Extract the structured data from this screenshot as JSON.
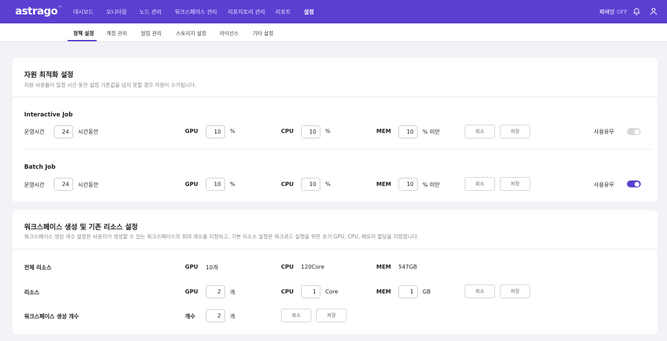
{
  "nav": {
    "logo": "astrago",
    "items": [
      "대시보드",
      "모니터링",
      "노드 관리",
      "워크스페이스 관리",
      "리포지토리 관리",
      "리포트",
      "설정"
    ],
    "active": "설정",
    "right_label": "폐쇄망",
    "right_state": "OFF"
  },
  "subnav": {
    "items": [
      "정책 설정",
      "계정 관리",
      "알림 관리",
      "스토리지 설정",
      "라이선스",
      "기타 설정"
    ],
    "active": "정책 설정"
  },
  "resource_opt": {
    "title": "자원 최적화 설정",
    "desc": "자원 사용률이 일정 시간 동안 설정 기준값을 넘지 못할 경우 자원이 수거됩니다.",
    "interactive": {
      "title": "Interactive Job",
      "runtime_label": "운영시간",
      "runtime_value": "24",
      "runtime_unit": "시간동안",
      "gpu_label": "GPU",
      "gpu_value": "10",
      "gpu_unit": "%",
      "cpu_label": "CPU",
      "cpu_value": "10",
      "cpu_unit": "%",
      "mem_label": "MEM",
      "mem_value": "10",
      "mem_unit": "% 미만",
      "cancel": "취소",
      "save": "저장",
      "use_label": "사용유무",
      "enabled": false
    },
    "batch": {
      "title": "Batch Job",
      "runtime_label": "운영시간",
      "runtime_value": "24",
      "runtime_unit": "시간동안",
      "gpu_label": "GPU",
      "gpu_value": "10",
      "gpu_unit": "%",
      "cpu_label": "CPU",
      "cpu_value": "10",
      "cpu_unit": "%",
      "mem_label": "MEM",
      "mem_value": "10",
      "mem_unit": "% 미만",
      "cancel": "취소",
      "save": "저장",
      "use_label": "사용유무",
      "enabled": true
    }
  },
  "workspace": {
    "title": "워크스페이스 생성 및 기존 리소스 설정",
    "desc": "워크스페이스 생성 개수 설정은 사용자가 생성할 수 있는 워크스페이스의 최대 개수를 지정하고, 기본 리소스 설정은 워크로드 실행을 위한 초기 GPU, CPU, 메모리 할당을 지정합니다.",
    "total": {
      "label": "전체 리소스",
      "gpu_label": "GPU",
      "gpu_value": "10개",
      "cpu_label": "CPU",
      "cpu_value": "120Core",
      "mem_label": "MEM",
      "mem_value": "547GB"
    },
    "resource": {
      "label": "리소스",
      "gpu_label": "GPU",
      "gpu_value": "2",
      "gpu_unit": "개",
      "cpu_label": "CPU",
      "cpu_value": "1",
      "cpu_unit": "Core",
      "mem_label": "MEM",
      "mem_value": "1",
      "mem_unit": "GB",
      "cancel": "취소",
      "save": "저장"
    },
    "count": {
      "label": "워크스페이스 생성 개수",
      "count_label": "개수",
      "count_value": "2",
      "count_unit": "개",
      "cancel": "취소",
      "save": "저장"
    }
  },
  "colors": {
    "accent": "#5b3fd1",
    "toggle_off": "#d8d8dc"
  }
}
